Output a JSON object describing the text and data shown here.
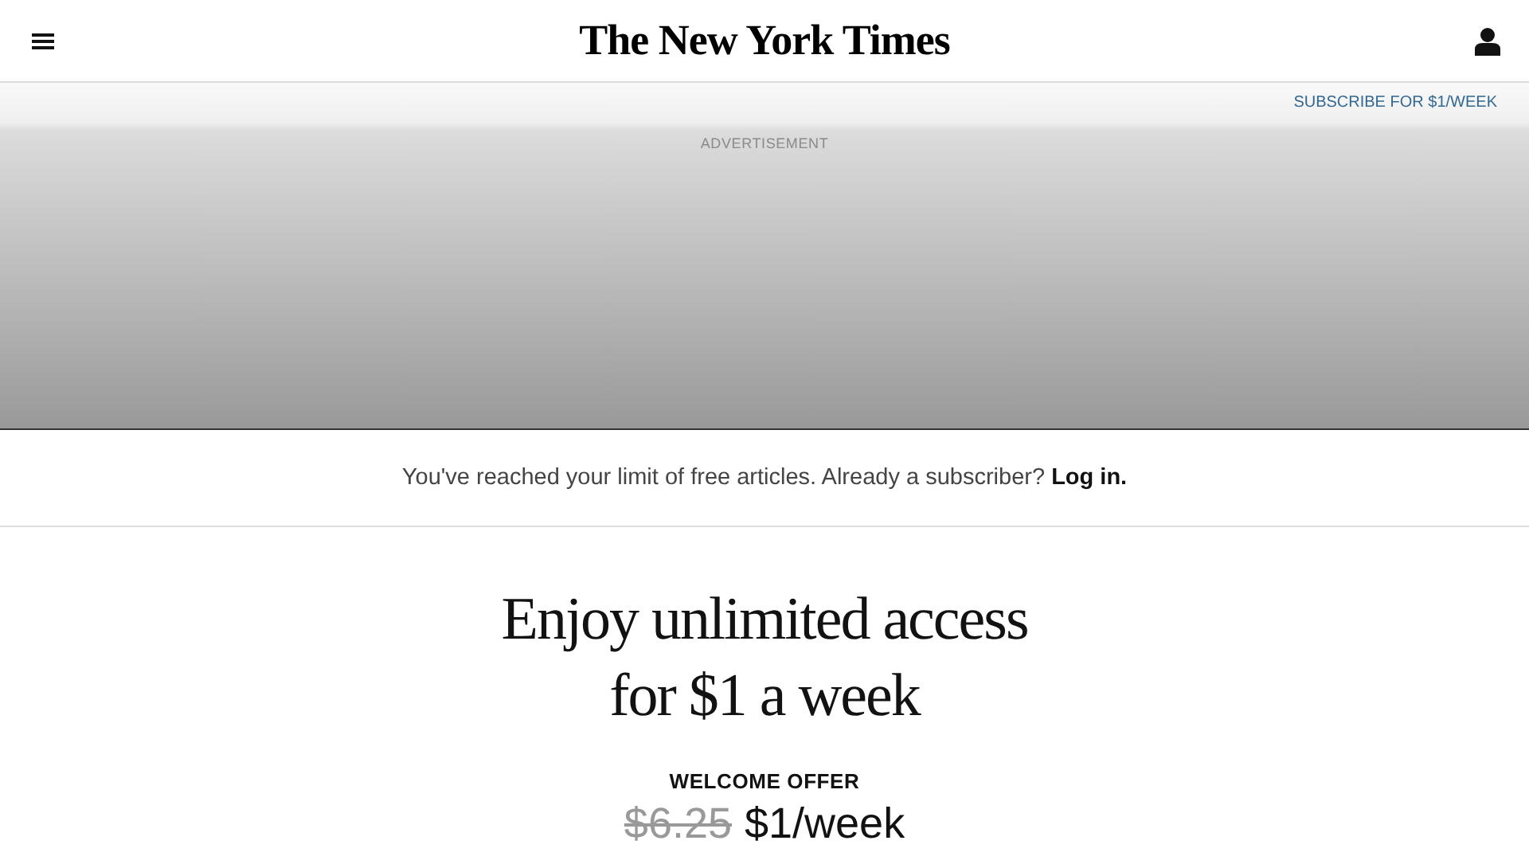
{
  "header": {
    "logo": "The New York Times"
  },
  "subscribe_link": "SUBSCRIBE FOR $1/WEEK",
  "advertisement": {
    "label": "ADVERTISEMENT"
  },
  "notice": {
    "text": "You've reached your limit of free articles. Already a subscriber?",
    "link": "Log in."
  },
  "offer": {
    "headline_lines": [
      "Enjoy unlimited access",
      "for $1 a week"
    ],
    "label": "WELCOME OFFER",
    "old_price": "$6.25",
    "new_price": "$1/week"
  }
}
